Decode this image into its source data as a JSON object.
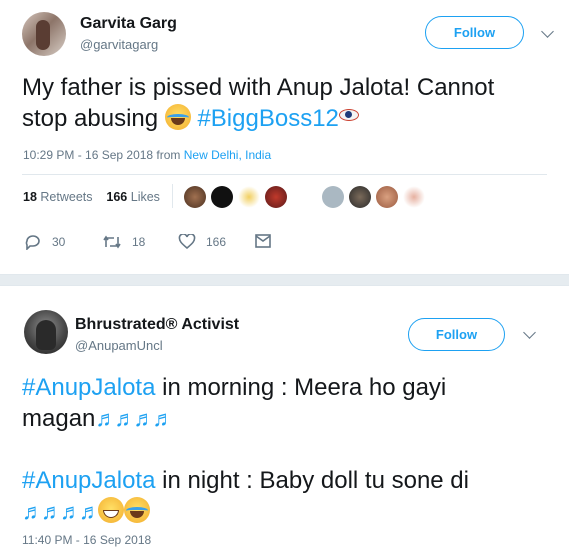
{
  "tweets": [
    {
      "name": "Garvita Garg",
      "handle": "@garvitagarg",
      "follow_label": "Follow",
      "text_parts": {
        "line1": "My father is pissed with Anup Jalota! Cannot",
        "line2_a": "stop abusing ",
        "hashtag": "#BiggBoss12"
      },
      "timestamp": "10:29 PM - 16 Sep 2018 from ",
      "location": "New Delhi, India",
      "retweets_count": "18",
      "retweets_label": "Retweets",
      "likes_count": "166",
      "likes_label": "Likes",
      "actions": {
        "reply": "30",
        "retweet": "18",
        "like": "166"
      }
    },
    {
      "name": "Bhrustrated® Activist",
      "handle": "@AnupamUncl",
      "follow_label": "Follow",
      "text_parts": {
        "hashtag1": "#AnupJalota",
        "line1_rest": " in morning : Meera ho gayi",
        "line2": "magan",
        "hashtag2": "#AnupJalota",
        "line3_rest": " in night : Baby doll tu sone di"
      },
      "timestamp": "11:40 PM - 16 Sep 2018"
    }
  ],
  "colors": {
    "accent": "#1da1f2",
    "muted": "#657786",
    "text": "#14171a",
    "divider": "#e6ecf0"
  }
}
